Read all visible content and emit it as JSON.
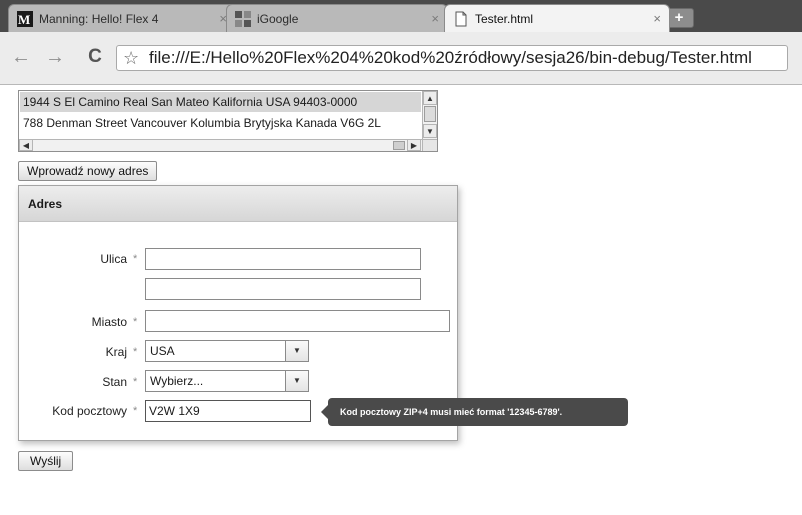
{
  "browser": {
    "tabs": [
      {
        "label": "Manning: Hello! Flex 4",
        "close": "×",
        "icon": "manning-m-icon"
      },
      {
        "label": "iGoogle",
        "close": "×",
        "icon": "igoogle-icon"
      },
      {
        "label": "Tester.html",
        "close": "×",
        "icon": "page-icon"
      }
    ],
    "new_tab": "+",
    "back": "←",
    "forward": "→",
    "reload": "C",
    "star": "☆",
    "url": "file:///E:/Hello%20Flex%204%20kod%20źródłowy/sesja26/bin-debug/Tester.html"
  },
  "address_list": {
    "items": [
      "1944 S El Camino Real San Mateo Kalifornia USA 94403-0000",
      "788 Denman Street Vancouver Kolumbia Brytyjska Kanada V6G 2L"
    ]
  },
  "new_address_button": "Wprowadź nowy adres",
  "form": {
    "title": "Adres",
    "required_marker": "*",
    "street_label": "Ulica",
    "street_value": "",
    "street2_value": "",
    "city_label": "Miasto",
    "city_value": "",
    "country_label": "Kraj",
    "country_value": "USA",
    "state_label": "Stan",
    "state_value": "Wybierz...",
    "zip_label": "Kod pocztowy",
    "zip_value": "V2W 1X9",
    "zip_error": "Kod pocztowy ZIP+4 musi mieć format '12345-6789'."
  },
  "submit_button": "Wyślij",
  "colors": {
    "selected_row": "#d6d6d6",
    "tooltip_bg": "#4a4a4a",
    "titlebar": "#4a4a4a"
  }
}
